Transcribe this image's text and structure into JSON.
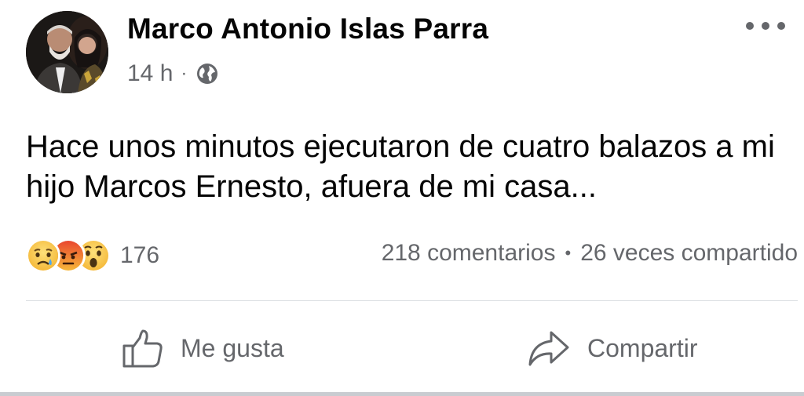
{
  "post": {
    "author": "Marco Antonio Islas Parra",
    "time": "14 h",
    "separator": "·",
    "privacy_icon": "globe-icon",
    "text": "Hace unos minutos ejecutaron de cuatro balazos a mi hijo Marcos Ernesto, afuera de mi casa..."
  },
  "reactions": {
    "icons": [
      "sad-emoji-icon",
      "angry-emoji-icon",
      "wow-emoji-icon"
    ],
    "count": "176"
  },
  "stats": {
    "comments": "218 comentarios",
    "separator": "•",
    "shares": "26 veces compartido"
  },
  "actions": {
    "like_label": "Me gusta",
    "share_label": "Compartir"
  },
  "colors": {
    "text": "#050505",
    "secondary": "#65676b",
    "divider": "#dadde1"
  }
}
